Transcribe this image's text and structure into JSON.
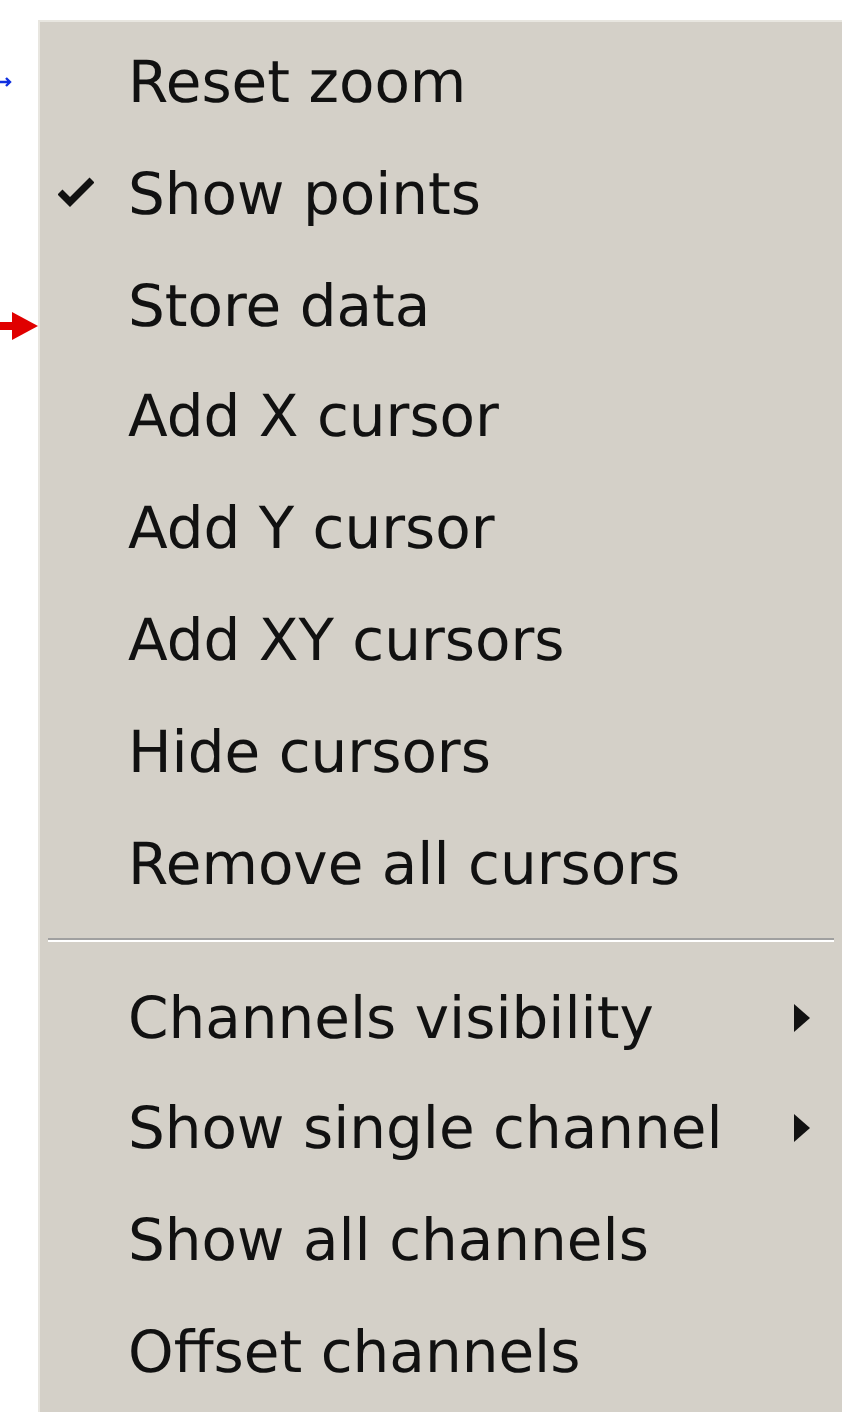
{
  "menu": {
    "items": [
      {
        "kind": "item",
        "label": "Reset zoom",
        "checked": false,
        "submenu": false
      },
      {
        "kind": "item",
        "label": "Show points",
        "checked": true,
        "submenu": false
      },
      {
        "kind": "item",
        "label": "Store data",
        "checked": false,
        "submenu": false
      },
      {
        "kind": "item",
        "label": "Add X cursor",
        "checked": false,
        "submenu": false
      },
      {
        "kind": "item",
        "label": "Add Y cursor",
        "checked": false,
        "submenu": false
      },
      {
        "kind": "item",
        "label": "Add XY cursors",
        "checked": false,
        "submenu": false
      },
      {
        "kind": "item",
        "label": "Hide cursors",
        "checked": false,
        "submenu": false
      },
      {
        "kind": "item",
        "label": "Remove all cursors",
        "checked": false,
        "submenu": false
      },
      {
        "kind": "separator"
      },
      {
        "kind": "item",
        "label": "Channels visibility",
        "checked": false,
        "submenu": true
      },
      {
        "kind": "item",
        "label": "Show single channel",
        "checked": false,
        "submenu": true
      },
      {
        "kind": "item",
        "label": "Show all channels",
        "checked": false,
        "submenu": false
      },
      {
        "kind": "item",
        "label": "Offset channels",
        "checked": false,
        "submenu": false
      }
    ]
  }
}
